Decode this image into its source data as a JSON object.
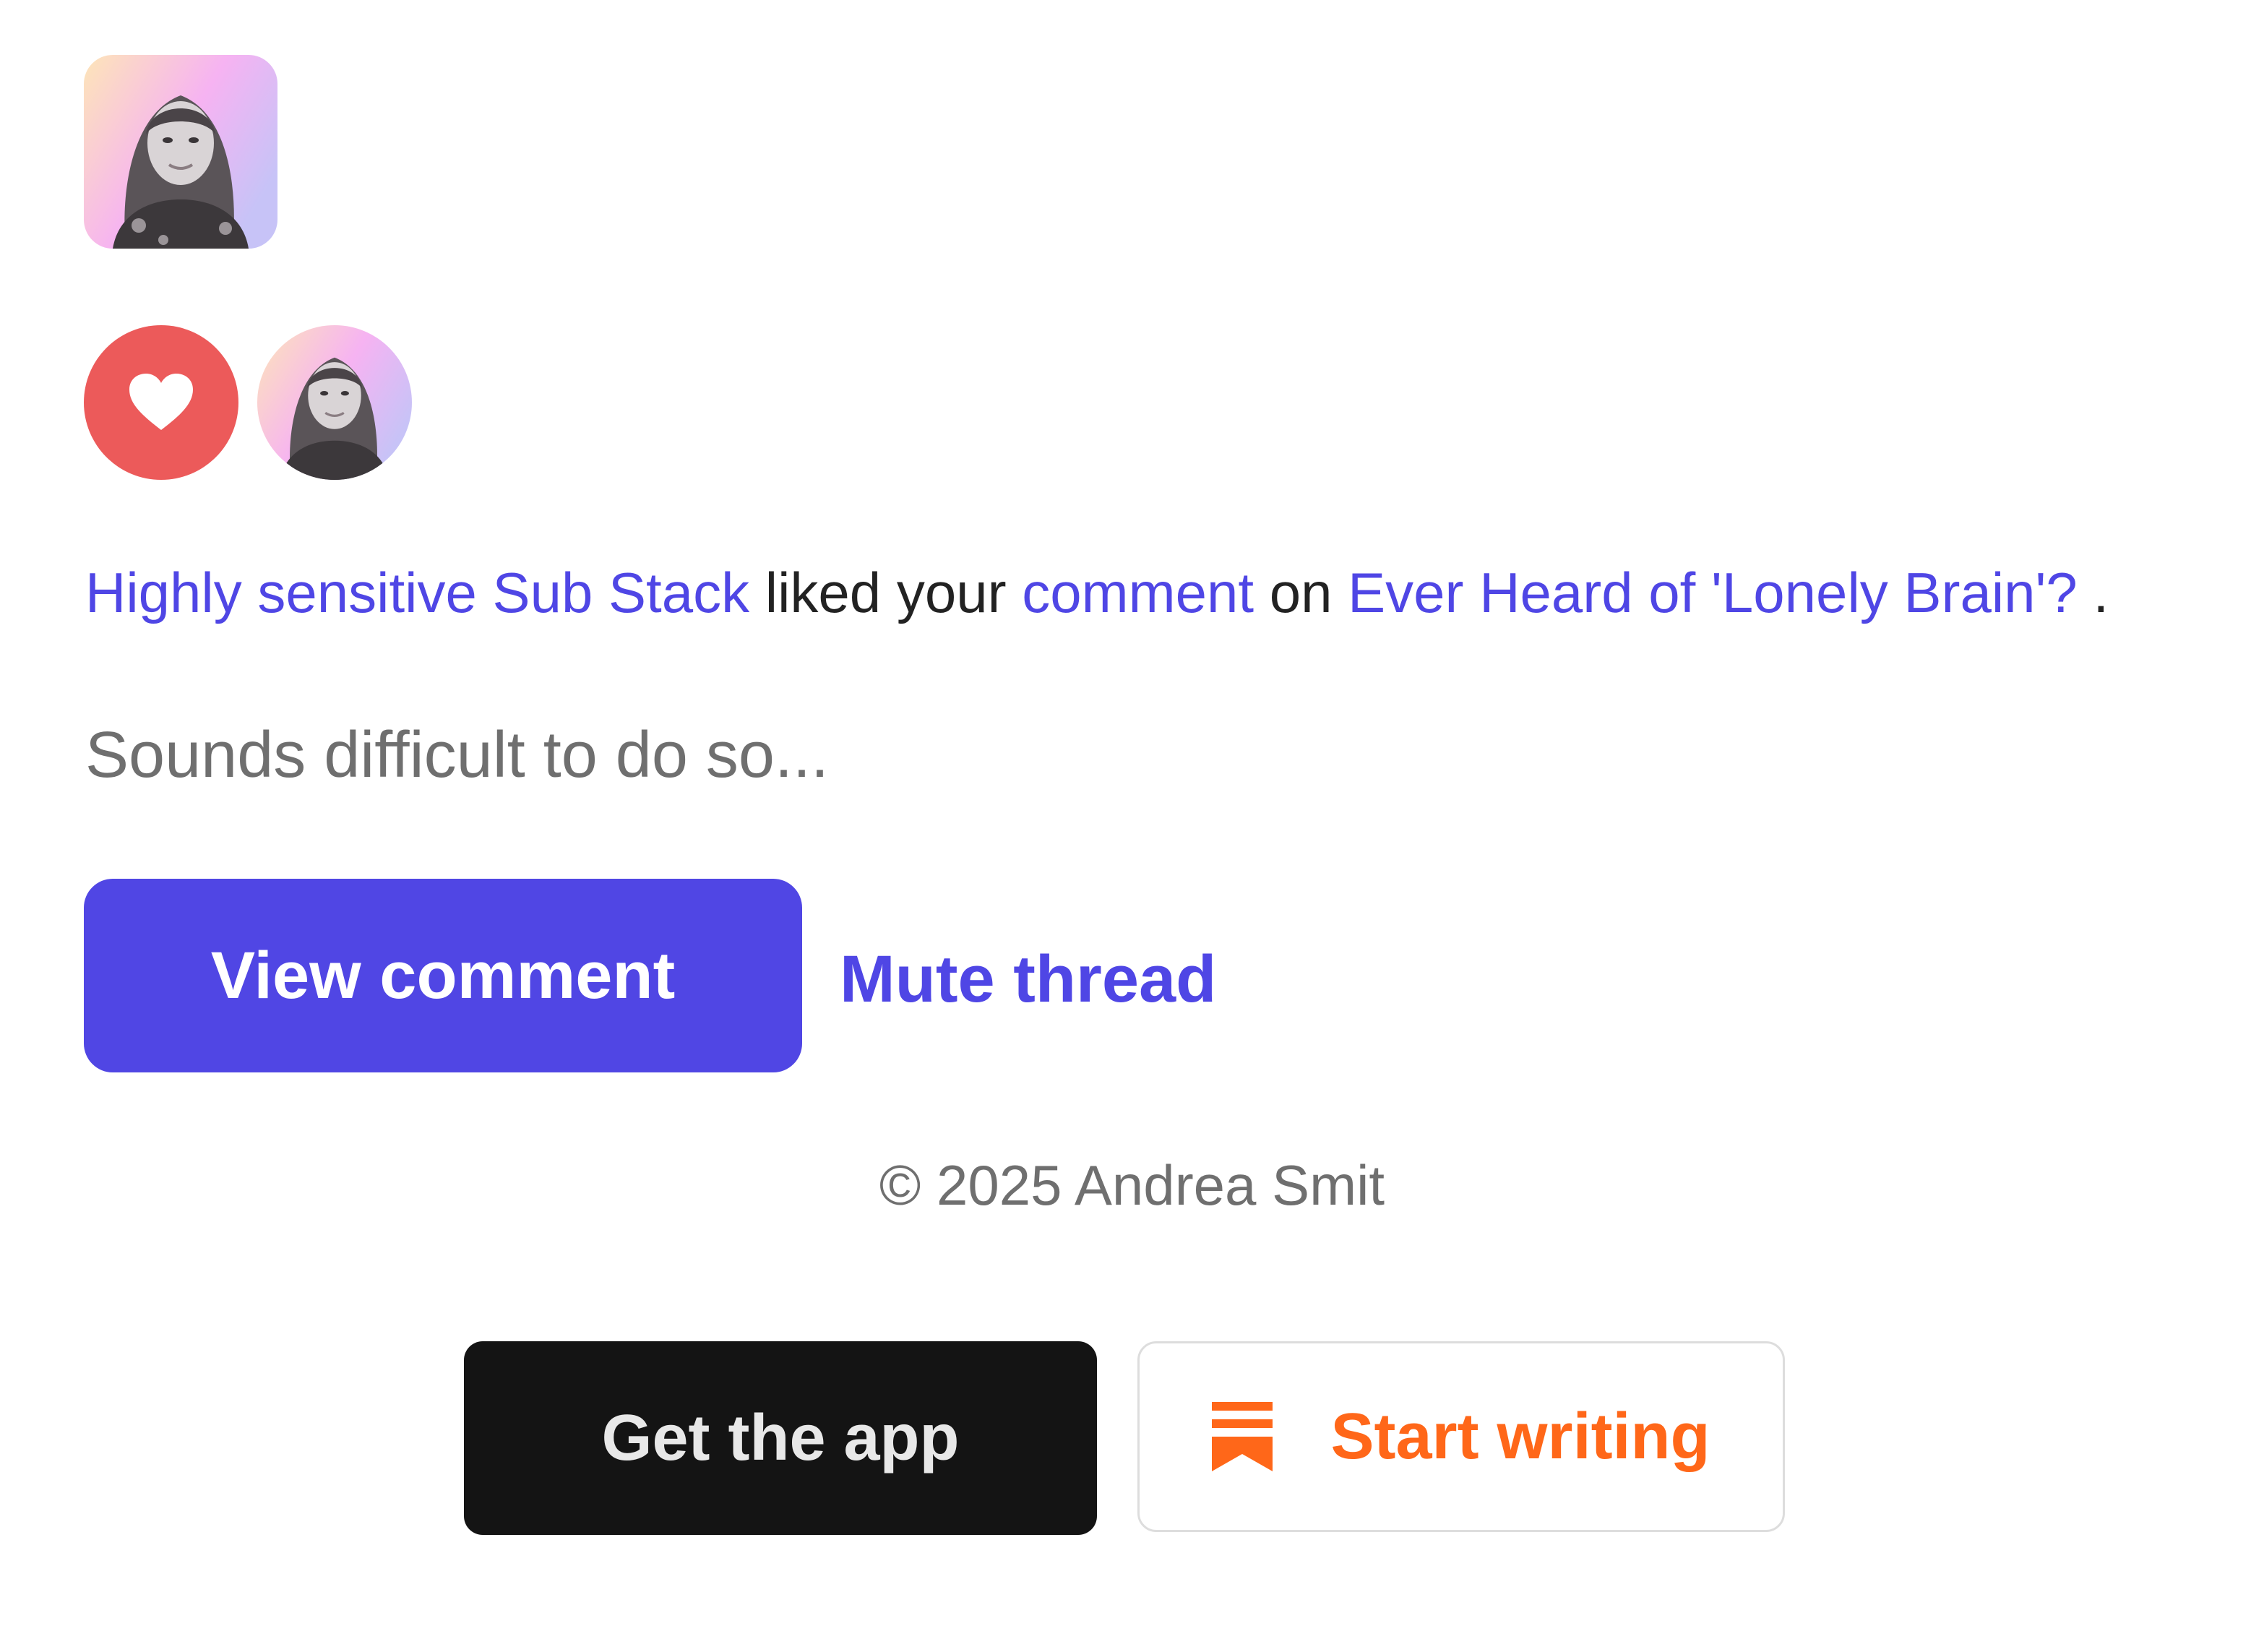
{
  "notification": {
    "actor": "Highly sensitive Sub Stack",
    "verb": "liked your",
    "object": "comment",
    "preposition": "on",
    "post_title": "Ever Heard of 'Lonely Brain'?",
    "end_punct": " ."
  },
  "snippet": "Sounds difficult to do so...",
  "actions": {
    "view_comment": "View comment",
    "mute_thread": "Mute thread"
  },
  "footer": {
    "copyright": "© 2025 Andrea Smit",
    "get_app": "Get the app",
    "start_writing": "Start writing"
  },
  "icons": {
    "reaction": "heart-icon",
    "write": "substack-bookmark-icon"
  },
  "colors": {
    "link": "#4f46e5",
    "primary_button": "#5046e4",
    "heart_bg": "#ec5a5a",
    "body_text": "#222222",
    "muted_text": "#6f6f6f",
    "app_button": "#141414",
    "substack_orange": "#ff6719"
  }
}
